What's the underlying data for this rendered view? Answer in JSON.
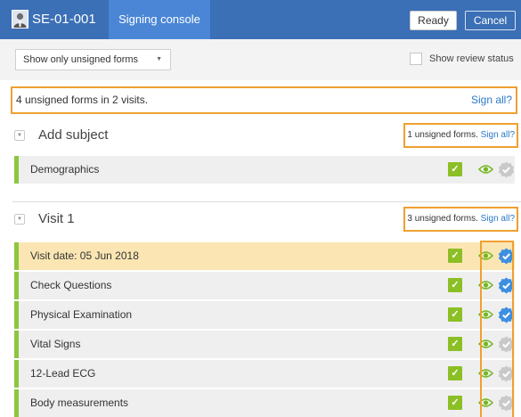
{
  "header": {
    "subject_id": "SE-01-001",
    "console_tab": "Signing console",
    "ready_label": "Ready",
    "cancel_label": "Cancel"
  },
  "filter": {
    "dropdown_value": "Show only unsigned forms",
    "review_status_label": "Show review status",
    "review_status_checked": false
  },
  "summary": {
    "text": "4 unsigned forms in 2 visits.",
    "sign_all": "Sign all?"
  },
  "sections": [
    {
      "title": "Add subject",
      "count_text": "1 unsigned forms.",
      "sign_all": "Sign all?",
      "forms": [
        {
          "label": "Demographics",
          "status": "unsigned",
          "highlighted": false
        }
      ]
    },
    {
      "title": "Visit 1",
      "count_text": "3 unsigned forms.",
      "sign_all": "Sign all?",
      "forms": [
        {
          "label": "Visit date: 05 Jun 2018",
          "status": "signed",
          "highlighted": true
        },
        {
          "label": "Check Questions",
          "status": "signed",
          "highlighted": false
        },
        {
          "label": "Physical Examination",
          "status": "signed",
          "highlighted": false
        },
        {
          "label": "Vital Signs",
          "status": "unsigned",
          "highlighted": false
        },
        {
          "label": "12-Lead ECG",
          "status": "unsigned",
          "highlighted": false
        },
        {
          "label": "Body measurements",
          "status": "unsigned",
          "highlighted": false
        }
      ]
    }
  ],
  "colors": {
    "header_bg": "#3b6fb6",
    "accent_tab": "#4b86d6",
    "highlight_border": "#f0a030",
    "row_marker": "#8dc63f",
    "check_green": "#8cbf26",
    "eye_green": "#74b81f",
    "signed_blue": "#3d8fe0",
    "unsigned_grey": "#c9c9c9"
  },
  "icons": {
    "avatar": "person-avatar-icon",
    "dropdown": "caret-down-icon",
    "section_toggle": "collapse-toggle-icon",
    "form_done": "checkmark-icon",
    "form_view": "eye-icon",
    "form_sign": "signature-badge-icon"
  }
}
